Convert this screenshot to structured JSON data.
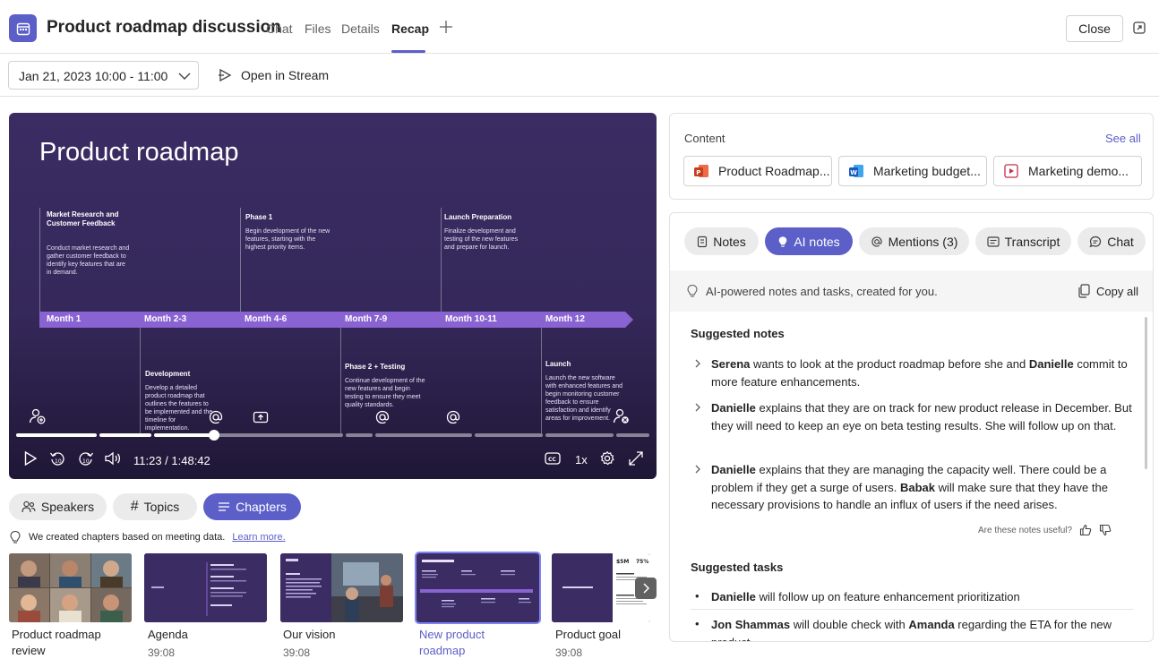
{
  "header": {
    "title": "Product roadmap discussion",
    "tabs": [
      "Chat",
      "Files",
      "Details",
      "Recap"
    ],
    "active_tab": "Recap",
    "close_label": "Close"
  },
  "subbar": {
    "date_range": "Jan 21, 2023 10:00 - 11:00",
    "open_in_stream": "Open in Stream"
  },
  "video": {
    "slide_title": "Product roadmap",
    "months": [
      "Month 1",
      "Month 2-3",
      "Month 4-6",
      "Month 7-9",
      "Month 10-11",
      "Month 12"
    ],
    "phases_top": [
      {
        "title": "Market Research and Customer Feedback",
        "desc": "Conduct market research and gather customer feedback to identify key features that are in demand."
      },
      {
        "title": "Phase 1",
        "desc": "Begin development of the new features, starting with the highest priority items."
      },
      {
        "title": "Launch Preparation",
        "desc": "Finalize development and testing of the new features and prepare for launch."
      }
    ],
    "phases_bottom": [
      {
        "title": "Development",
        "desc": "Develop a detailed product roadmap that outlines the features to be implemented and the timeline for implementation."
      },
      {
        "title": "Phase 2 + Testing",
        "desc": "Continue development of the new features and begin testing to ensure they meet quality standards."
      },
      {
        "title": "Launch",
        "desc": "Launch the new software with enhanced features and begin monitoring customer feedback to ensure satisfaction and identify areas for improvement."
      }
    ],
    "current_time": "11:23 / 1:48:42",
    "speed": "1x",
    "progress": 0.31
  },
  "view_tabs": {
    "speakers": "Speakers",
    "topics": "Topics",
    "chapters": "Chapters",
    "active": "Chapters"
  },
  "chapters_info": {
    "text": "We created chapters based on meeting data.",
    "link": "Learn more."
  },
  "chapters": [
    {
      "title": "Product roadmap review",
      "time": ""
    },
    {
      "title": "Agenda",
      "time": "39:08"
    },
    {
      "title": "Our vision",
      "time": "39:08"
    },
    {
      "title": "New product roadmap",
      "time": ""
    },
    {
      "title": "Product goal",
      "time": "39:08"
    }
  ],
  "content": {
    "title": "Content",
    "see_all": "See all",
    "files": [
      {
        "name": "Product Roadmap...",
        "type": "powerpoint"
      },
      {
        "name": "Marketing budget...",
        "type": "word"
      },
      {
        "name": "Marketing demo...",
        "type": "video"
      }
    ]
  },
  "notes_tabs": {
    "notes": "Notes",
    "ai_notes": "AI notes",
    "mentions": "Mentions (3)",
    "transcript": "Transcript",
    "chat": "Chat",
    "active": "AI notes"
  },
  "ai_banner": {
    "text": "AI-powered notes and tasks, created for you.",
    "copy_all": "Copy all"
  },
  "suggested_notes": {
    "heading": "Suggested notes",
    "items": [
      {
        "name": "Serena",
        "t1": " wants to look at the product roadmap before she and ",
        "name2": "Danielle",
        "t2": " commit to more feature enhancements."
      },
      {
        "name": "Danielle",
        "t1": " explains that they are on track for new product release in December. But they will need to keep an eye on beta testing results. She will follow up on that.",
        "name2": "",
        "t2": ""
      },
      {
        "name": "Danielle",
        "t1": " explains that they are managing the capacity well. There could be a problem if they get a surge of users. ",
        "name2": "Babak",
        "t2": " will make sure that they have the necessary provisions to handle an influx of users if the need arises."
      }
    ],
    "feedback": "Are these notes useful?"
  },
  "suggested_tasks": {
    "heading": "Suggested tasks",
    "items": [
      {
        "name": "Danielle",
        "t1": " will follow up on feature enhancement prioritization",
        "name2": "",
        "t2": ""
      },
      {
        "name": "Jon Shammas",
        "t1": " will double check with ",
        "name2": "Amanda",
        "t2": " regarding the ETA for the new product"
      }
    ]
  }
}
